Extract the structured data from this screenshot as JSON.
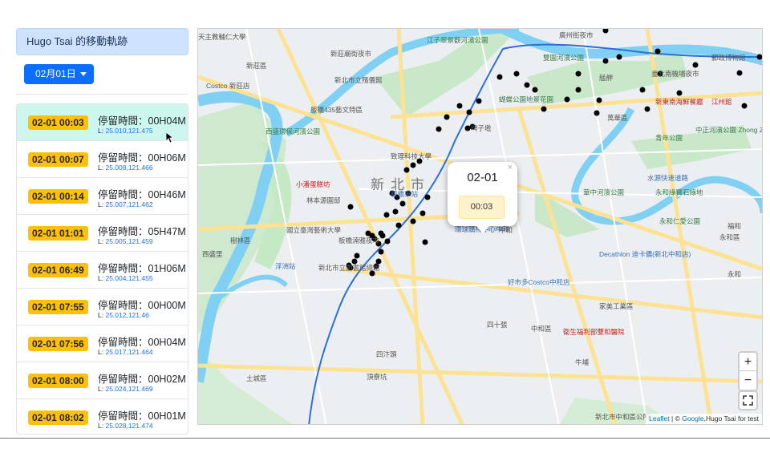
{
  "sidebar": {
    "title": "Hugo Tsai 的移動軌跡",
    "date_button": "02月01日",
    "stays": [
      {
        "time": "02-01 00:03",
        "duration": "停留時間：00H04M",
        "prefix": "L:",
        "coords": "25.010,121.475",
        "active": true
      },
      {
        "time": "02-01 00:07",
        "duration": "停留時間：00H06M",
        "prefix": "L:",
        "coords": "25.008,121.466"
      },
      {
        "time": "02-01 00:14",
        "duration": "停留時間：00H46M",
        "prefix": "L:",
        "coords": "25.007,121.462"
      },
      {
        "time": "02-01 01:01",
        "duration": "停留時間：05H47M",
        "prefix": "L:",
        "coords": "25.005,121.459"
      },
      {
        "time": "02-01 06:49",
        "duration": "停留時間：01H06M",
        "prefix": "L:",
        "coords": "25.004,121.455"
      },
      {
        "time": "02-01 07:55",
        "duration": "停留時間：00H00M",
        "prefix": "L:",
        "coords": "25.012,121.46"
      },
      {
        "time": "02-01 07:56",
        "duration": "停留時間：00H04M",
        "prefix": "L:",
        "coords": "25.017,121.464"
      },
      {
        "time": "02-01 08:00",
        "duration": "停留時間：00H02M",
        "prefix": "L:",
        "coords": "25.024,121.469"
      },
      {
        "time": "02-01 08:02",
        "duration": "停留時間：00H01M",
        "prefix": "L:",
        "coords": "25.028,121.474"
      }
    ]
  },
  "map": {
    "popup": {
      "date": "02-01",
      "time": "00:03",
      "close": "×"
    },
    "zoom_in": "+",
    "zoom_out": "−",
    "attribution": {
      "leaflet": "Leaflet",
      "sep": " | © ",
      "google": "Google",
      "rest": ",Hugo Tsai for test"
    },
    "labels": {
      "district": "新北市",
      "l1": "江子翠景觀河濱公園",
      "l2": "新莊廟街夜市",
      "l3": "新北市立殯儀館",
      "l4": "板橋435藝文特區",
      "l5": "西盛環保河濱公園",
      "l6": "致理科技大學",
      "l7": "小潘蛋糕坊",
      "l8": "林本源園邸",
      "l9": "板橋車站",
      "l10": "環球購物中心中和",
      "l11": "國立臺灣藝術大學",
      "l12": "板橋湳雅夜市",
      "l13": "新北市立圖書館總館",
      "l14": "浮洲站",
      "l15": "好市多Costco中和店",
      "l16": "家美工業區",
      "l17": "四十張",
      "l18": "中和區",
      "l19": "衛生福利部雙和醫院",
      "l20": "華中河濱公園",
      "l21": "永和綠寶石綠地",
      "l22": "永和仁愛公園",
      "l23": "永和區",
      "l24": "Decathlon 迪卡儂(新北中和店)",
      "l25": "中正河濱公園 Zhong Zheng Riverside Park",
      "l26": "萬華區",
      "l27": "青年公園",
      "l28": "蝴蝶公園地景花園",
      "l29": "雙園河濱公園",
      "l30": "臺北南機場夜市",
      "l31": "新東南海鮮餐廳",
      "l32": "江州館",
      "l33": "廣州街夜市",
      "l34": "郵政博物館",
      "l35": "天主教輔仁大學",
      "l36": "新莊區",
      "l37": "樹林區",
      "l38": "土城區",
      "l39": "四汴頭",
      "l40": "頂寮坑",
      "l41": "新北市中和區公所",
      "l42": "Costco 新莊店",
      "l43": "永和",
      "l44": "中和",
      "l45": "福和",
      "l46": "水源快速道路",
      "l47": "艋舺",
      "l48": "埤子墘",
      "l49": "西盛里",
      "l50": "牛埔"
    }
  },
  "colors": {
    "accent": "#0d6efd",
    "badge": "#ffc107",
    "active_row": "#cdf7ee",
    "title_bg": "#cfe2ff",
    "river": "#7fd0f3",
    "park": "#c5e8c5",
    "road": "#fde293",
    "mrt": "#2f6fd6"
  }
}
